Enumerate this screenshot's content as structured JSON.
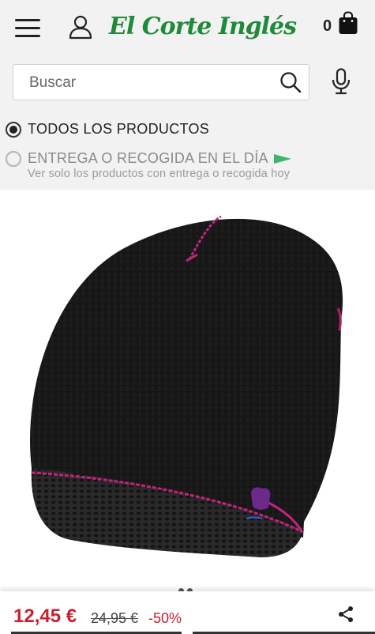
{
  "header": {
    "logo_text": "El Corte Inglés",
    "cart_count": "0",
    "brand_color": "#1f8a3a"
  },
  "search": {
    "placeholder": "Buscar"
  },
  "filters": {
    "all_products": "TODOS LOS PRODUCTOS",
    "delivery": "ENTREGA O RECOGIDA EN EL DÍA",
    "delivery_sub": "Ver solo los productos con entrega o recogida hoy"
  },
  "product": {
    "price": "12,45 €",
    "old_price": "24,95 €",
    "discount": "-50%",
    "price_color": "#c8202f"
  },
  "icons": [
    "menu-icon",
    "user-icon",
    "shopping-bag-icon",
    "search-icon",
    "microphone-icon",
    "flag-icon",
    "share-icon"
  ]
}
